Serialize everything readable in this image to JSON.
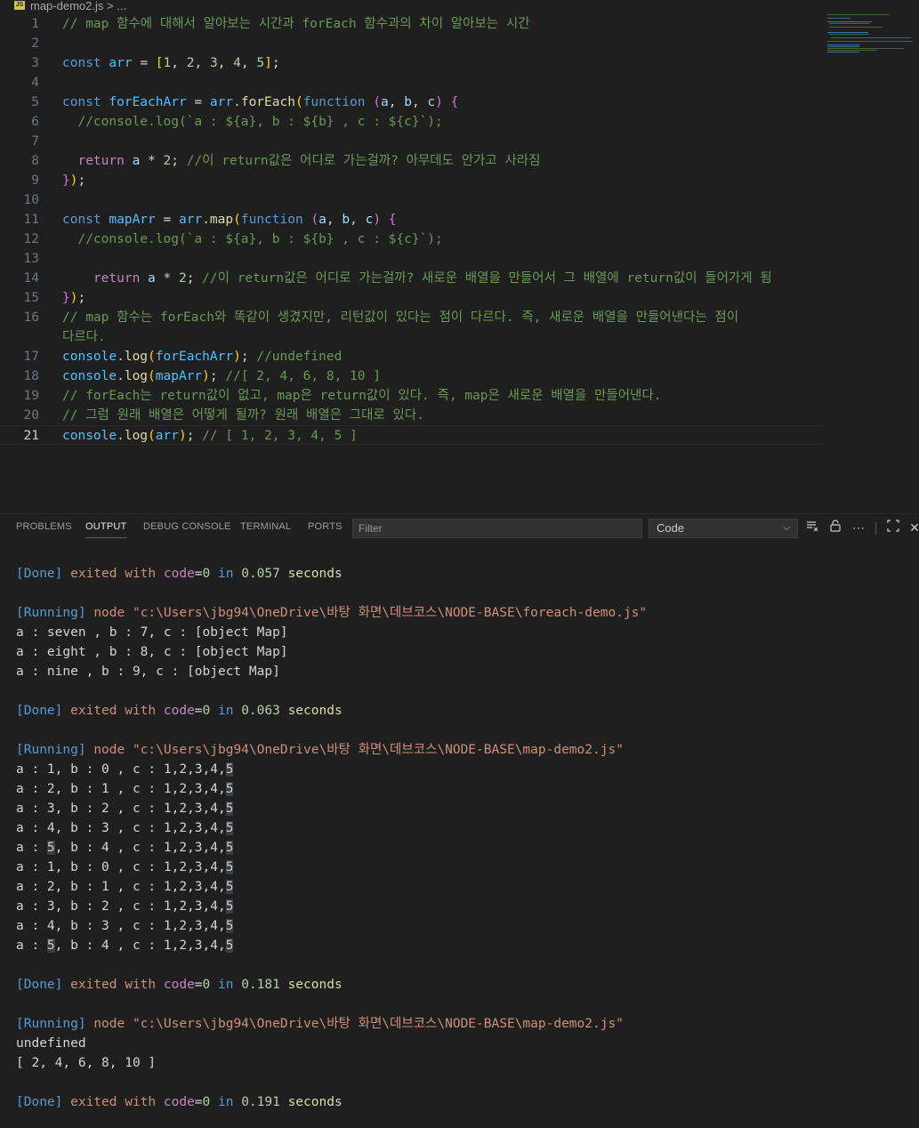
{
  "breadcrumb": {
    "file_icon": "JS",
    "file": "map-demo2.js",
    "separator": ">",
    "rest": "..."
  },
  "editor": {
    "line_numbers": [
      "1",
      "2",
      "3",
      "4",
      "5",
      "6",
      "7",
      "8",
      "9",
      "10",
      "11",
      "12",
      "13",
      "14",
      "15",
      "16",
      "",
      "17",
      "18",
      "19",
      "20",
      "21"
    ],
    "lines": [
      [
        [
          "cm",
          "// map 함수에 대해서 알아보는 시간과 forEach 함수과의 차이 알아보는 시간"
        ]
      ],
      [],
      [
        [
          "kw",
          "const "
        ],
        [
          "vr",
          "arr"
        ],
        [
          "tx",
          " = "
        ],
        [
          "br1",
          "["
        ],
        [
          "nm",
          "1"
        ],
        [
          "tx",
          ", "
        ],
        [
          "nm",
          "2"
        ],
        [
          "tx",
          ", "
        ],
        [
          "nm",
          "3"
        ],
        [
          "tx",
          ", "
        ],
        [
          "nm",
          "4"
        ],
        [
          "tx",
          ", "
        ],
        [
          "nm",
          "5"
        ],
        [
          "br1",
          "]"
        ],
        [
          "tx",
          ";"
        ]
      ],
      [],
      [
        [
          "kw",
          "const "
        ],
        [
          "vr",
          "forEachArr"
        ],
        [
          "tx",
          " = "
        ],
        [
          "vr",
          "arr"
        ],
        [
          "tx",
          "."
        ],
        [
          "fn",
          "forEach"
        ],
        [
          "br1",
          "("
        ],
        [
          "kw",
          "function "
        ],
        [
          "br2",
          "("
        ],
        [
          "pm",
          "a"
        ],
        [
          "tx",
          ", "
        ],
        [
          "pm",
          "b"
        ],
        [
          "tx",
          ", "
        ],
        [
          "pm",
          "c"
        ],
        [
          "br2",
          ")"
        ],
        [
          "tx",
          " "
        ],
        [
          "br2",
          "{"
        ]
      ],
      [
        [
          "cm",
          "  //console.log(`a : ${a}, b : ${b} , c : ${c}`);"
        ]
      ],
      [],
      [
        [
          "tx",
          "  "
        ],
        [
          "kw2",
          "return "
        ],
        [
          "pm",
          "a"
        ],
        [
          "tx",
          " * "
        ],
        [
          "nm",
          "2"
        ],
        [
          "tx",
          "; "
        ],
        [
          "cm",
          "//이 return값은 어디로 가는걸까? 아무데도 안가고 사라짐"
        ]
      ],
      [
        [
          "br2",
          "}"
        ],
        [
          "br1",
          ")"
        ],
        [
          "tx",
          ";"
        ]
      ],
      [],
      [
        [
          "kw",
          "const "
        ],
        [
          "vr",
          "mapArr"
        ],
        [
          "tx",
          " = "
        ],
        [
          "vr",
          "arr"
        ],
        [
          "tx",
          "."
        ],
        [
          "fn",
          "map"
        ],
        [
          "br1",
          "("
        ],
        [
          "kw",
          "function "
        ],
        [
          "br2",
          "("
        ],
        [
          "pm",
          "a"
        ],
        [
          "tx",
          ", "
        ],
        [
          "pm",
          "b"
        ],
        [
          "tx",
          ", "
        ],
        [
          "pm",
          "c"
        ],
        [
          "br2",
          ")"
        ],
        [
          "tx",
          " "
        ],
        [
          "br2",
          "{"
        ]
      ],
      [
        [
          "cm",
          "  //console.log(`a : ${a}, b : ${b} , c : ${c}`);"
        ]
      ],
      [],
      [
        [
          "tx",
          "    "
        ],
        [
          "kw2",
          "return "
        ],
        [
          "pm",
          "a"
        ],
        [
          "tx",
          " * "
        ],
        [
          "nm",
          "2"
        ],
        [
          "tx",
          "; "
        ],
        [
          "cm",
          "//이 return값은 어디로 가는걸까? 새로운 배열을 만들어서 그 배열에 return값이 들어가게 됨"
        ]
      ],
      [
        [
          "br2",
          "}"
        ],
        [
          "br1",
          ")"
        ],
        [
          "tx",
          ";"
        ]
      ],
      [
        [
          "cm",
          "// map 함수는 forEach와 똑같이 생겼지만, 리턴값이 있다는 점이 다르다. 즉, 새로운 배열을 만들어낸다는 점이"
        ]
      ],
      [
        [
          "cm",
          "다르다."
        ]
      ],
      [
        [
          "vr",
          "console"
        ],
        [
          "tx",
          "."
        ],
        [
          "fn",
          "log"
        ],
        [
          "br1",
          "("
        ],
        [
          "vr",
          "forEachArr"
        ],
        [
          "br1",
          ")"
        ],
        [
          "tx",
          "; "
        ],
        [
          "cm",
          "//undefined"
        ]
      ],
      [
        [
          "vr",
          "console"
        ],
        [
          "tx",
          "."
        ],
        [
          "fn",
          "log"
        ],
        [
          "br1",
          "("
        ],
        [
          "vr",
          "mapArr"
        ],
        [
          "br1",
          ")"
        ],
        [
          "tx",
          "; "
        ],
        [
          "cm",
          "//[ 2, 4, 6, 8, 10 ]"
        ]
      ],
      [
        [
          "cm",
          "// forEach는 return값이 없고, map은 return값이 있다. 즉, map은 새로운 배열을 만들어낸다."
        ]
      ],
      [
        [
          "cm",
          "// 그럼 원래 배열은 어떻게 될까? 원래 배열은 그대로 있다."
        ]
      ],
      [
        [
          "vr",
          "console"
        ],
        [
          "tx",
          "."
        ],
        [
          "fn",
          "log"
        ],
        [
          "br1",
          "("
        ],
        [
          "vr",
          "arr"
        ],
        [
          "br1",
          ")"
        ],
        [
          "tx",
          "; "
        ],
        [
          "cm",
          "// [ 1, 2, 3, 4, 5 ]"
        ]
      ]
    ]
  },
  "panel": {
    "tabs": [
      "PROBLEMS",
      "OUTPUT",
      "DEBUG CONSOLE",
      "TERMINAL",
      "PORTS"
    ],
    "active_tab": "OUTPUT",
    "filter_placeholder": "Filter",
    "channel": "Code"
  },
  "output": {
    "lines": [
      [
        [
          "o-tag",
          "[Done] "
        ],
        [
          "o-word",
          "exited with "
        ],
        [
          "o-code",
          "code"
        ],
        [
          "o-plain",
          "="
        ],
        [
          "o-num",
          "0"
        ],
        [
          "o-kw",
          " in "
        ],
        [
          "o-num",
          "0.057"
        ],
        [
          "o-sec",
          " seconds"
        ]
      ],
      [],
      [
        [
          "o-tag",
          "[Running] "
        ],
        [
          "o-word",
          "node "
        ],
        [
          "o-str",
          "\"c:\\Users\\jbg94\\OneDrive\\바탕 화면\\데브코스\\NODE-BASE\\foreach-demo.js\""
        ]
      ],
      [
        [
          "o-plain",
          "a : seven , b : 7, c : [object Map]"
        ]
      ],
      [
        [
          "o-plain",
          "a : eight , b : 8, c : [object Map]"
        ]
      ],
      [
        [
          "o-plain",
          "a : nine , b : 9, c : [object Map]"
        ]
      ],
      [],
      [
        [
          "o-tag",
          "[Done] "
        ],
        [
          "o-word",
          "exited with "
        ],
        [
          "o-code",
          "code"
        ],
        [
          "o-plain",
          "="
        ],
        [
          "o-num",
          "0"
        ],
        [
          "o-kw",
          " in "
        ],
        [
          "o-num",
          "0.063"
        ],
        [
          "o-sec",
          " seconds"
        ]
      ],
      [],
      [
        [
          "o-tag",
          "[Running] "
        ],
        [
          "o-word",
          "node "
        ],
        [
          "o-str",
          "\"c:\\Users\\jbg94\\OneDrive\\바탕 화면\\데브코스\\NODE-BASE\\map-demo2.js\""
        ]
      ],
      [
        [
          "o-plain",
          "a : 1, b : 0 , c : 1,2,3,4,"
        ],
        [
          "hl",
          "5"
        ]
      ],
      [
        [
          "o-plain",
          "a : 2, b : 1 , c : 1,2,3,4,"
        ],
        [
          "hl",
          "5"
        ]
      ],
      [
        [
          "o-plain",
          "a : 3, b : 2 , c : 1,2,3,4,"
        ],
        [
          "hl",
          "5"
        ]
      ],
      [
        [
          "o-plain",
          "a : 4, b : 3 , c : 1,2,3,4,"
        ],
        [
          "hl",
          "5"
        ]
      ],
      [
        [
          "o-plain",
          "a : "
        ],
        [
          "hl",
          "5"
        ],
        [
          "o-plain",
          ", b : 4 , c : 1,2,3,4,"
        ],
        [
          "hl",
          "5"
        ]
      ],
      [
        [
          "o-plain",
          "a : 1, b : 0 , c : 1,2,3,4,"
        ],
        [
          "hl",
          "5"
        ]
      ],
      [
        [
          "o-plain",
          "a : 2, b : 1 , c : 1,2,3,4,"
        ],
        [
          "hl",
          "5"
        ]
      ],
      [
        [
          "o-plain",
          "a : 3, b : 2 , c : 1,2,3,4,"
        ],
        [
          "hl",
          "5"
        ]
      ],
      [
        [
          "o-plain",
          "a : 4, b : 3 , c : 1,2,3,4,"
        ],
        [
          "hl",
          "5"
        ]
      ],
      [
        [
          "o-plain",
          "a : "
        ],
        [
          "hl",
          "5"
        ],
        [
          "o-plain",
          ", b : 4 , c : 1,2,3,4,"
        ],
        [
          "hl",
          "5"
        ]
      ],
      [],
      [
        [
          "o-tag",
          "[Done] "
        ],
        [
          "o-word",
          "exited with "
        ],
        [
          "o-code",
          "code"
        ],
        [
          "o-plain",
          "="
        ],
        [
          "o-num",
          "0"
        ],
        [
          "o-kw",
          " in "
        ],
        [
          "o-num",
          "0.181"
        ],
        [
          "o-sec",
          " seconds"
        ]
      ],
      [],
      [
        [
          "o-tag",
          "[Running] "
        ],
        [
          "o-word",
          "node "
        ],
        [
          "o-str",
          "\"c:\\Users\\jbg94\\OneDrive\\바탕 화면\\데브코스\\NODE-BASE\\map-demo2.js\""
        ]
      ],
      [
        [
          "o-plain",
          "undefined"
        ]
      ],
      [
        [
          "o-plain",
          "[ 2, 4, 6, 8, 10 ]"
        ]
      ],
      [],
      [
        [
          "o-tag",
          "[Done] "
        ],
        [
          "o-word",
          "exited with "
        ],
        [
          "o-code",
          "code"
        ],
        [
          "o-plain",
          "="
        ],
        [
          "o-num",
          "0"
        ],
        [
          "o-kw",
          " in "
        ],
        [
          "o-num",
          "0.191"
        ],
        [
          "o-sec",
          " seconds"
        ]
      ]
    ]
  },
  "icons": {
    "clear": "clear-output-icon",
    "lock": "lock-icon",
    "more": "more-icon",
    "maximize": "maximize-icon",
    "close": "close-icon"
  }
}
